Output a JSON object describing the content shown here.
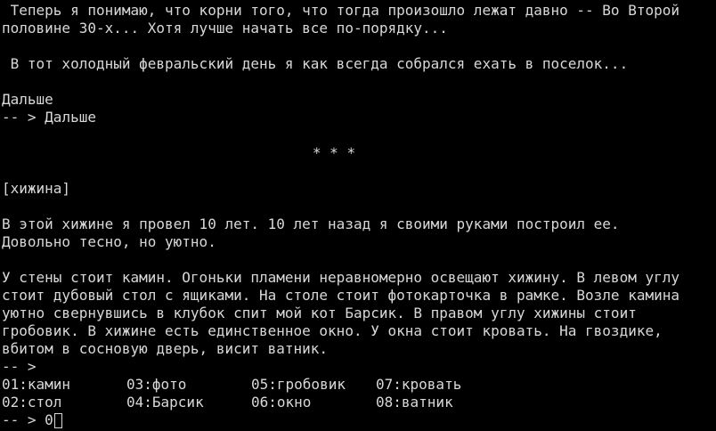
{
  "story": {
    "intro_line_1": " Теперь я понимаю, что корни того, что тогда произошло лежат давно -- Во Второй",
    "intro_line_2": "половине 30-х... Хотя лучше начать все по-порядку...",
    "paragraph_line": " В тот холодный февральский день я как всегда собрался ехать в поселок...",
    "continue_choice": "Дальше",
    "echo_prompt": "-- > ",
    "echo_text": "Дальше",
    "separator": "* * *",
    "location_title": "[хижина]",
    "desc_1": "В этой хижине я провел 10 лет. 10 лет назад я своими руками построил ее.",
    "desc_2": "Довольно тесно, но уютно.",
    "room_1": "У стены стоит камин. Огоньки пламени неравномерно освещают хижину. В левом углу",
    "room_2": "стоит дубовый стол с ящиками. На столе стоит фотокарточка в рамке. Возле камина",
    "room_3": "уютно свернувшись в клубок спит мой кот Барсик. В правом углу хижины стоит",
    "room_4": "гробовик. В хижине есть единственное окно. У окна стоит кровать. На гвоздике,",
    "room_5": "вбитом в сосновую дверь, висит ватник.",
    "empty_prompt": "-- >"
  },
  "menu": {
    "row1": [
      "01:камин",
      "03:фото",
      "05:гробовик",
      "07:кровать"
    ],
    "row2": [
      "02:стол",
      "04:Барсик",
      "06:окно",
      "08:ватник"
    ]
  },
  "input": {
    "prompt": "-- > ",
    "value": "0"
  }
}
